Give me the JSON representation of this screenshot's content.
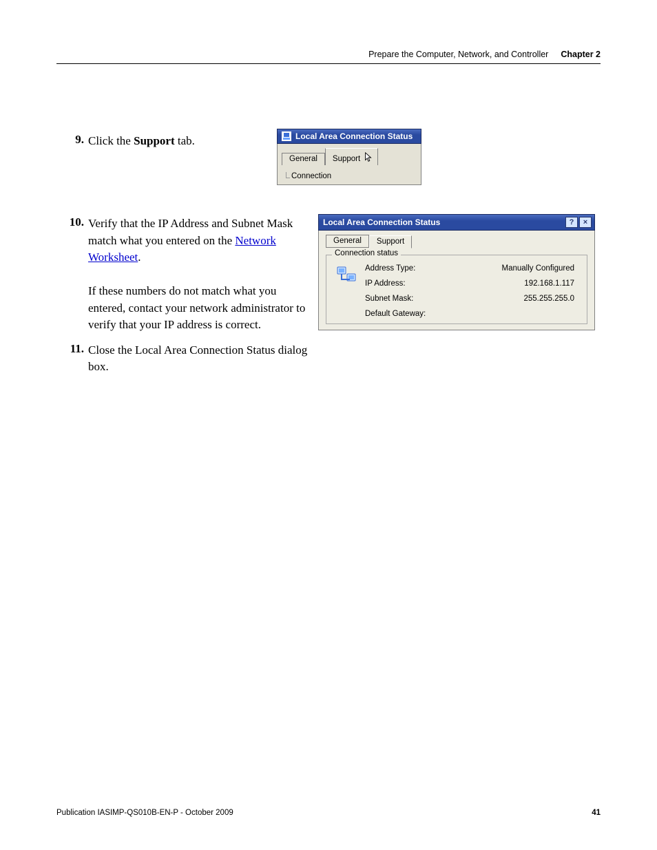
{
  "header": {
    "light": "Prepare the Computer, Network, and Controller",
    "bold": "Chapter 2"
  },
  "steps": {
    "s9": {
      "num": "9.",
      "pre": "Click the ",
      "bold": "Support",
      "post": " tab."
    },
    "s10": {
      "num": "10.",
      "line1a": "Verify that the IP Address and Subnet Mask match what you entered on the ",
      "link": "Network Worksheet",
      "line1b": ".",
      "para2": "If these numbers do not match what you entered, contact your network administrator to verify that your IP address is correct."
    },
    "s11": {
      "num": "11.",
      "text": "Close the Local Area Connection Status dialog box."
    }
  },
  "shot1": {
    "title": "Local Area Connection Status",
    "tab_general": "General",
    "tab_support": "Support",
    "connection_label": "Connection"
  },
  "shot2": {
    "title": "Local Area Connection Status",
    "help_glyph": "?",
    "close_glyph": "×",
    "tab_general": "General",
    "tab_support": "Support",
    "group_legend": "Connection status",
    "labels": {
      "address_type": "Address Type:",
      "ip_address": "IP Address:",
      "subnet_mask": "Subnet Mask:",
      "default_gateway": "Default Gateway:"
    },
    "values": {
      "address_type": "Manually Configured",
      "ip_address": "192.168.1.117",
      "subnet_mask": "255.255.255.0",
      "default_gateway": ""
    }
  },
  "footer": {
    "pub": "Publication IASIMP-QS010B-EN-P - October 2009",
    "page": "41"
  }
}
